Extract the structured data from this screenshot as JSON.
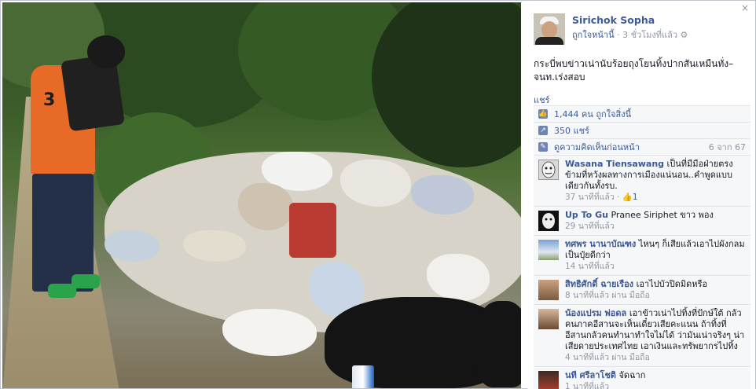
{
  "post": {
    "author": "Sirichok Sopha",
    "liked_label": "ถูกใจหน้านี้",
    "time": "3 ชั่วโมงที่แล้ว",
    "caption": "กระบี่พบข่าวเน่านับร้อยถุงโยนทิ้งปากสันเหมืนทั่ง–จนท.เร่งสอบ",
    "share_label": "แชร์",
    "close": "×"
  },
  "stats": {
    "likes": "1,444 คน ถูกใจสิ่งนี้",
    "shares": "350 แชร์",
    "view_prev": "ดูความคิดเห็นก่อนหน้า",
    "count": "6 จาก 67"
  },
  "comments": [
    {
      "name": "Wasana Tiensawang",
      "text": "เป็นที่มีมือฝ่ายตรงข้ามที่หวังผลทางการเมืองแน่นอน..คำพูดแบบเดียวกันทั้งรบ.",
      "time": "37 นาทีที่แล้ว",
      "likes": "1"
    },
    {
      "name": "Up To Gu",
      "text": "Pranee Siriphet ขาว พอง",
      "time": "29 นาทีที่แล้ว"
    },
    {
      "name": "ทศพร นานาบัณฑง",
      "text": "ไหนๆ ก็เสียแล้วเอาไปผังกลมเป็นปุ๋ยดีกว่า",
      "time": "14 นาทีที่แล้ว"
    },
    {
      "name": "สิทธิศักดิ์ ฉายเรือง",
      "text": "เอาไปบัวปิดมิดหรือ",
      "time": "8 นาทีที่แล้ว ผ่าน มือถือ"
    },
    {
      "name": "น้องแปรม พ่อดล",
      "text": "เอาข้าวเน่าไปทิ้งที่ปักษ์ใต้ กลัวคนภาคอีสานจะเห็นเดี๋ยวเสียคะแนน ถ้าทิ้งที่อีสานกลัวคนทำนาทำใจไม่ได้ ว่ามันเน่าจริงๆ น่าเสียดายประเทศไทย เอาเงินและทรัพยากรไปทิ้ง",
      "time": "4 นาทีที่แล้ว ผ่าน มือถือ"
    },
    {
      "name": "นที ศรีลาโชติ",
      "text": "จัดฉาก",
      "time": "1 นาทีที่แล้ว"
    }
  ],
  "colors": {
    "link": "#3b5998",
    "muted": "#9197a3",
    "shirt": "#e86a27"
  },
  "photo": {
    "shirt_number": "3"
  }
}
